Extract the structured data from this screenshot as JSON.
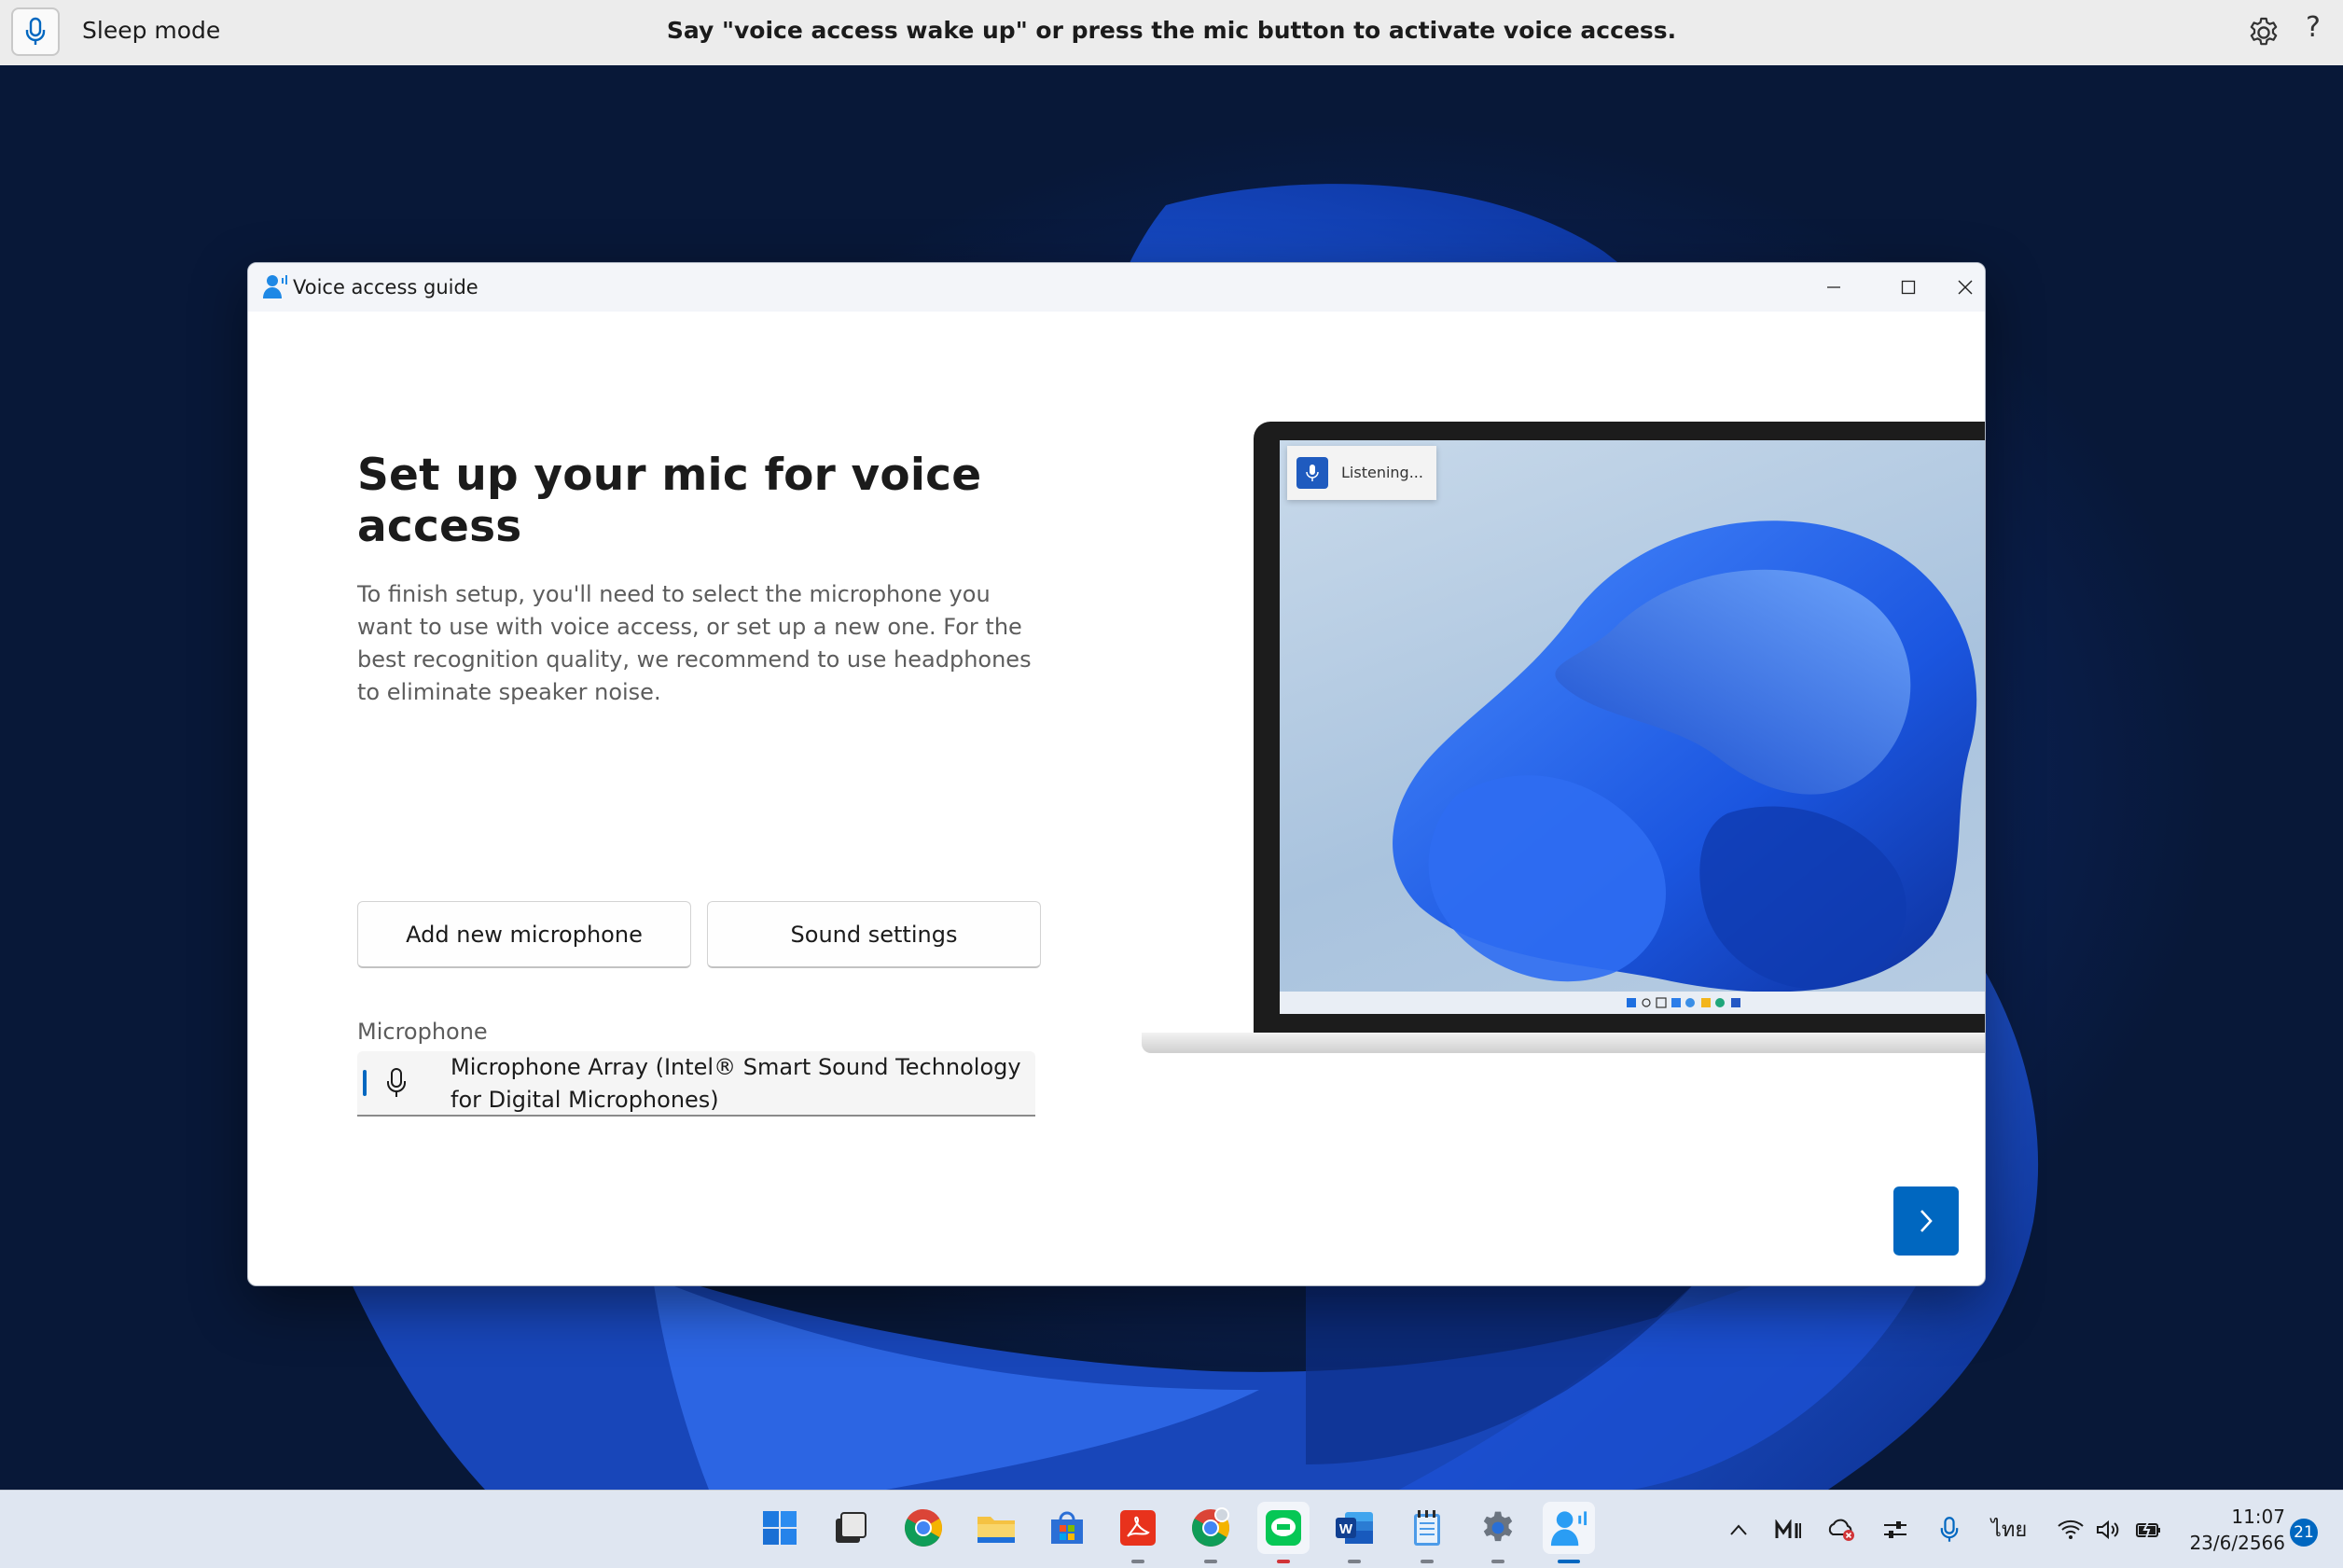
{
  "voice_bar": {
    "mode": "Sleep mode",
    "hint": "Say \"voice access wake up\" or press the mic button to activate voice access.",
    "settings_icon": "gear-icon",
    "help_label": "?"
  },
  "window": {
    "title": "Voice access guide",
    "heading": "Set up your mic for voice access",
    "description": "To finish setup, you'll need to select the microphone you want to use with voice access, or set up a new one. For the best recognition quality, we recommend to use headphones to eliminate speaker noise.",
    "microphone_label": "Microphone",
    "microphone_selected": "Microphone Array (Intel® Smart Sound Technology for Digital Microphones)",
    "add_button": "Add new microphone",
    "sound_button": "Sound settings",
    "illustration_listening": "Listening..."
  },
  "taskbar": {
    "apps": [
      "start",
      "task-view",
      "chrome",
      "file-explorer",
      "microsoft-store",
      "acrobat",
      "chrome-profile",
      "line",
      "word",
      "notepad",
      "settings",
      "voice-access"
    ],
    "tray_language": "ไทย",
    "time": "11:07",
    "date": "23/6/2566",
    "notifications": "21"
  },
  "colors": {
    "accent": "#0067c0",
    "wallpaper_dark": "#0a1f4f",
    "wallpaper_bloom": "#1f5ee6"
  }
}
